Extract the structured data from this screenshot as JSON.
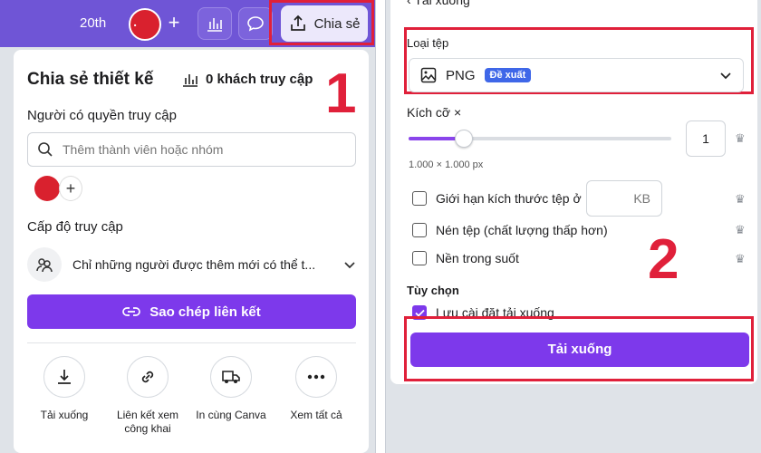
{
  "left": {
    "topbar": {
      "year_label": "20th",
      "plus_label": "+",
      "share_label": "Chia sẻ"
    },
    "header": {
      "title": "Chia sẻ thiết kế",
      "viewers": "0 khách truy cập",
      "step_number": "1"
    },
    "people": {
      "heading": "Người có quyền truy cập",
      "search_placeholder": "Thêm thành viên hoặc nhóm",
      "add_label": "+"
    },
    "access": {
      "heading": "Cấp độ truy cập",
      "value": "Chỉ những người được thêm mới có thể t..."
    },
    "copy_link_label": "Sao chép liên kết",
    "actions": [
      {
        "label": "Tải xuống",
        "icon": "download-icon"
      },
      {
        "label": "Liên kết xem công khai",
        "icon": "link-icon"
      },
      {
        "label": "In cùng Canva",
        "icon": "truck-icon"
      },
      {
        "label": "Xem tất cả",
        "icon": "more-icon"
      }
    ]
  },
  "right": {
    "top_partial": "Tải xuống",
    "file_type": {
      "label": "Loại tệp",
      "value": "PNG",
      "badge": "Đề xuất"
    },
    "size": {
      "label": "Kích cỡ ×",
      "value": "1",
      "slider_fraction": 0.21,
      "dimensions": "1.000 × 1.000 px"
    },
    "options": [
      {
        "label": "Giới hạn kích thước tệp ở",
        "checked": false
      },
      {
        "label": "Nén tệp (chất lượng thấp hơn)",
        "checked": false
      },
      {
        "label": "Nền trong suốt",
        "checked": false
      }
    ],
    "kb_unit": "KB",
    "step_number": "2",
    "advanced": {
      "label": "Tùy chọn",
      "save_settings": "Lưu cài đặt tải xuống",
      "save_checked": true
    },
    "download_label": "Tải xuống"
  },
  "colors": {
    "brand_purple": "#7d39eb",
    "topbar_purple": "#6f55d6",
    "highlight_red": "#e0203a",
    "badge_blue": "#3f67e8"
  }
}
